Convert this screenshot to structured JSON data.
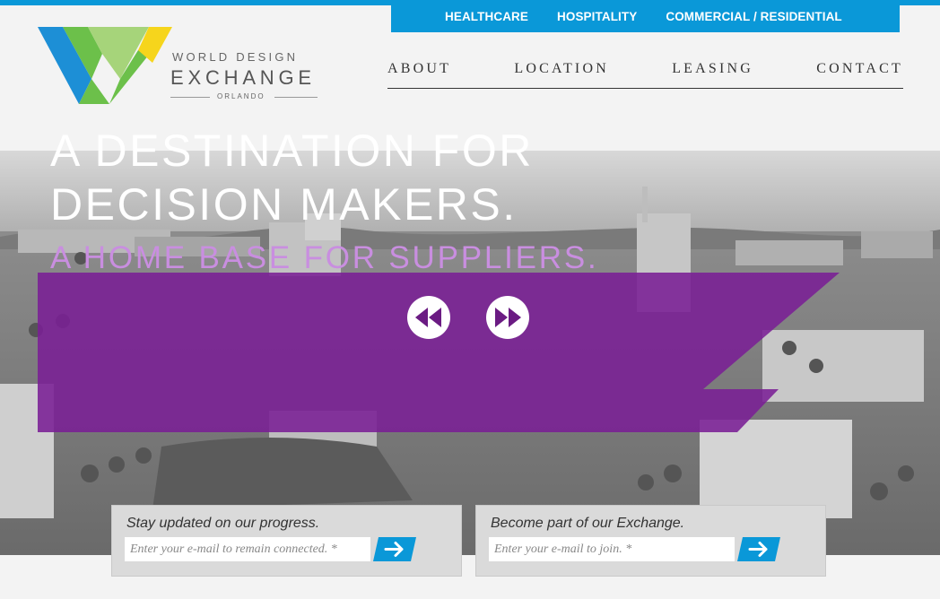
{
  "header": {
    "sectors": [
      "HEALTHCARE",
      "HOSPITALITY",
      "COMMERCIAL / RESIDENTIAL"
    ],
    "logo": {
      "line1": "WORLD DESIGN",
      "line2": "EXCHANGE",
      "line3": "ORLANDO"
    },
    "nav": [
      "ABOUT",
      "LOCATION",
      "LEASING",
      "CONTACT"
    ]
  },
  "hero": {
    "headline_line1": "A DESTINATION FOR",
    "headline_line2": "DECISION MAKERS.",
    "subhead": "A HOME BASE FOR SUPPLIERS."
  },
  "signup": {
    "progress": {
      "title": "Stay updated on our progress.",
      "placeholder": "Enter your e-mail to remain connected. *"
    },
    "join": {
      "title": "Become part of our Exchange.",
      "placeholder": "Enter your e-mail to join. *"
    }
  },
  "colors": {
    "accent_blue": "#0a98d8",
    "banner_purple": "#7a1f95",
    "subhead_lilac": "#c98ee0",
    "logo_blue": "#1d8fd6",
    "logo_green": "#6cc04a",
    "logo_light_green": "#a6d47a",
    "logo_yellow": "#f6d51c"
  },
  "icons": {
    "prev": "rewind-icon",
    "next": "fast-forward-icon",
    "submit": "arrow-right-icon"
  }
}
